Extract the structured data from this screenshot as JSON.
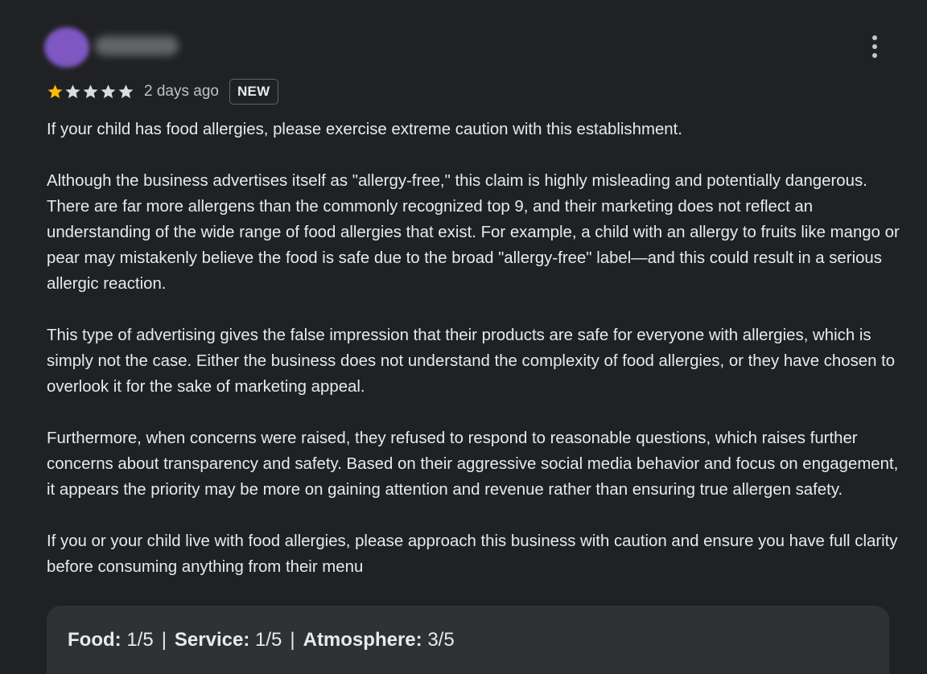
{
  "review": {
    "rating_stars": 1,
    "rating_max": 5,
    "date": "2 days ago",
    "badge": "NEW",
    "paragraphs": [
      "If your child has food allergies, please exercise extreme caution with this establishment.",
      "Although the business advertises itself as \"allergy-free,\" this claim is highly misleading and potentially dangerous. There are far more allergens than the commonly recognized top 9, and their marketing does not reflect an understanding of the wide range of food allergies that exist. For example, a child with an allergy to fruits like mango or pear may mistakenly believe the food is safe due to the broad \"allergy-free\" label—and this could result in a serious allergic reaction.",
      "This type of advertising gives the false impression that their products are safe for everyone with allergies, which is simply not the case. Either the business does not understand the complexity of food allergies, or they have chosen to overlook it for the sake of marketing appeal.",
      "Furthermore, when concerns were raised, they refused to respond to reasonable questions, which raises further concerns about transparency and safety. Based on their aggressive social media behavior and focus on engagement, it appears the priority may be more on gaining attention and revenue rather than ensuring true allergen safety.",
      "If you or your child live with food allergies, please approach this business with caution and ensure you have full clarity before consuming anything from their menu"
    ],
    "sub_ratings": [
      {
        "label": "Food:",
        "value": "1/5"
      },
      {
        "label": "Service:",
        "value": "1/5"
      },
      {
        "label": "Atmosphere:",
        "value": "3/5"
      }
    ],
    "separator": "|"
  },
  "icons": {
    "more": "more-vert-icon",
    "star": "star-icon"
  },
  "colors": {
    "background": "#202124",
    "star_filled": "#fbbc04",
    "star_empty": "#dadce0",
    "avatar": "#7e57c2",
    "ratings_box": "#303134"
  }
}
